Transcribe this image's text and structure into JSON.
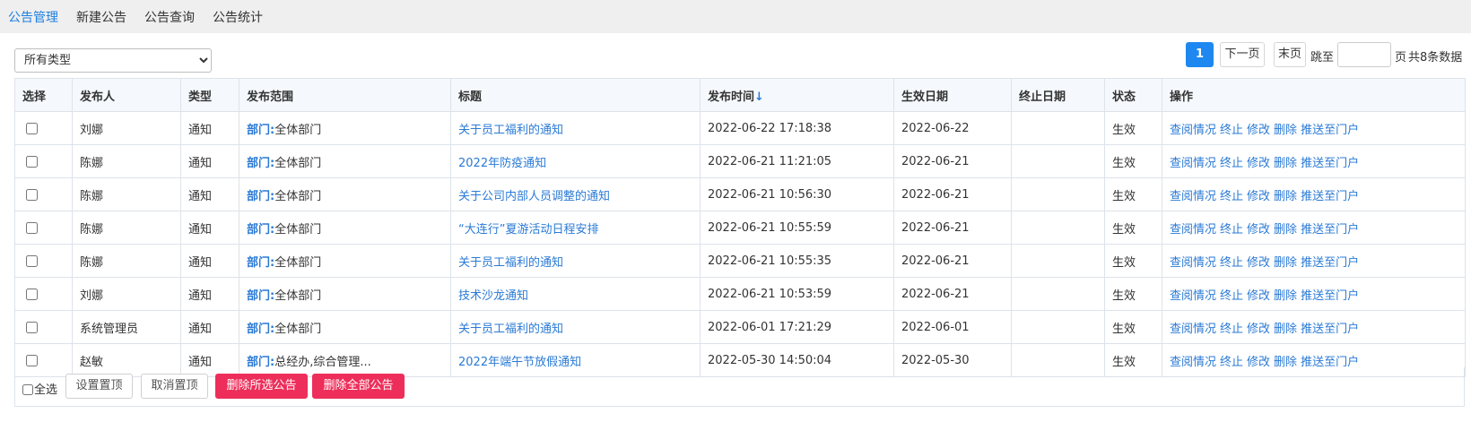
{
  "nav": {
    "items": [
      {
        "label": "公告管理",
        "active": true
      },
      {
        "label": "新建公告",
        "active": false
      },
      {
        "label": "公告查询",
        "active": false
      },
      {
        "label": "公告统计",
        "active": false
      }
    ]
  },
  "filter": {
    "type_select": {
      "selected": "所有类型"
    }
  },
  "pager": {
    "current_page": "1",
    "next_label": "下一页",
    "last_label": "末页",
    "jump_label": "跳至",
    "page_unit": "页",
    "total_text": "共8条数据"
  },
  "table": {
    "headers": {
      "select": "选择",
      "publisher": "发布人",
      "type": "类型",
      "scope": "发布范围",
      "title": "标题",
      "time": "发布时间",
      "time_sort_icon": "↓",
      "effective": "生效日期",
      "end": "终止日期",
      "status": "状态",
      "ops": "操作"
    },
    "scope_label": "部门:",
    "ops": [
      "查阅情况",
      "终止",
      "修改",
      "删除",
      "推送至门户"
    ],
    "rows": [
      {
        "publisher": "刘娜",
        "type": "通知",
        "scope": "全体部门",
        "title": "关于员工福利的通知",
        "time": "2022-06-22 17:18:38",
        "effective": "2022-06-22",
        "end": "",
        "status": "生效"
      },
      {
        "publisher": "陈娜",
        "type": "通知",
        "scope": "全体部门",
        "title": "2022年防疫通知",
        "time": "2022-06-21 11:21:05",
        "effective": "2022-06-21",
        "end": "",
        "status": "生效"
      },
      {
        "publisher": "陈娜",
        "type": "通知",
        "scope": "全体部门",
        "title": "关于公司内部人员调整的通知",
        "time": "2022-06-21 10:56:30",
        "effective": "2022-06-21",
        "end": "",
        "status": "生效"
      },
      {
        "publisher": "陈娜",
        "type": "通知",
        "scope": "全体部门",
        "title": "“大连行”夏游活动日程安排",
        "time": "2022-06-21 10:55:59",
        "effective": "2022-06-21",
        "end": "",
        "status": "生效"
      },
      {
        "publisher": "陈娜",
        "type": "通知",
        "scope": "全体部门",
        "title": "关于员工福利的通知",
        "time": "2022-06-21 10:55:35",
        "effective": "2022-06-21",
        "end": "",
        "status": "生效"
      },
      {
        "publisher": "刘娜",
        "type": "通知",
        "scope": "全体部门",
        "title": "技术沙龙通知",
        "time": "2022-06-21 10:53:59",
        "effective": "2022-06-21",
        "end": "",
        "status": "生效"
      },
      {
        "publisher": "系统管理员",
        "type": "通知",
        "scope": "全体部门",
        "title": "关于员工福利的通知",
        "time": "2022-06-01 17:21:29",
        "effective": "2022-06-01",
        "end": "",
        "status": "生效"
      },
      {
        "publisher": "赵敏",
        "type": "通知",
        "scope": "总经办,综合管理...",
        "title": "2022年端午节放假通知",
        "time": "2022-05-30 14:50:04",
        "effective": "2022-05-30",
        "end": "",
        "status": "生效"
      }
    ]
  },
  "footer": {
    "select_all": "全选",
    "set_top": "设置置顶",
    "cancel_top": "取消置顶",
    "delete_selected": "删除所选公告",
    "delete_all": "删除全部公告"
  },
  "colors": {
    "accent": "#1e88f0",
    "link": "#2a7ad5",
    "status_active": "#2e9e3a",
    "danger": "#ee2e5a"
  }
}
